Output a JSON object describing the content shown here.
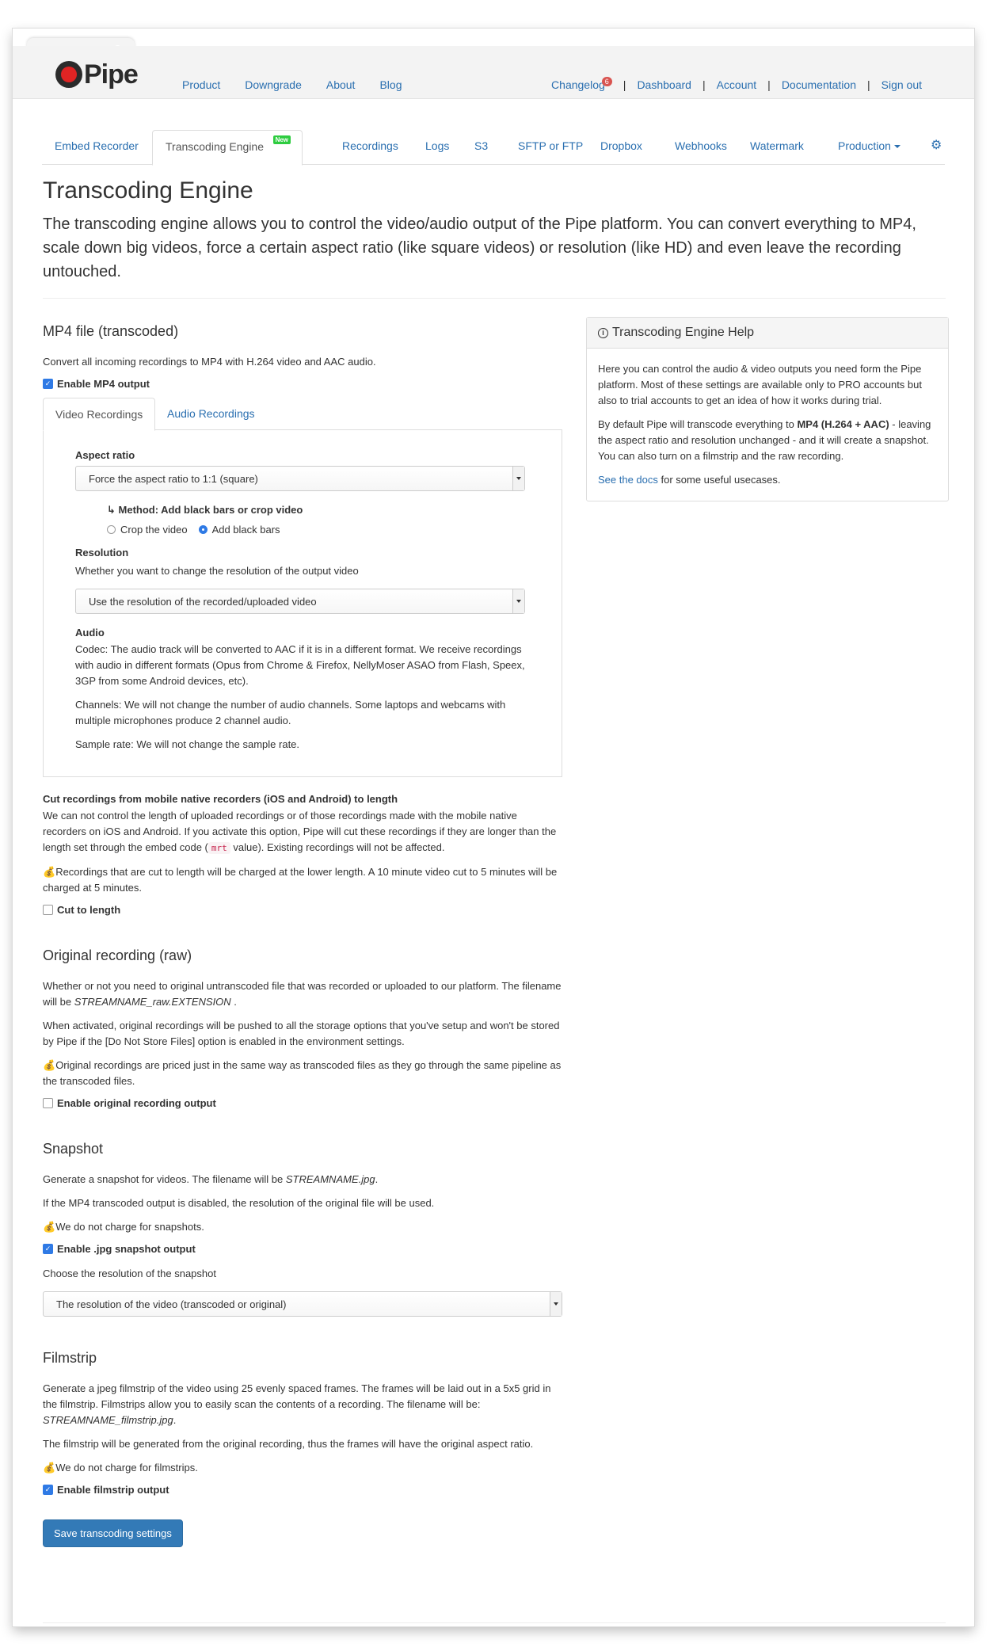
{
  "navbar": {
    "logo_text": "Pipe",
    "left_links": [
      "Product",
      "Downgrade",
      "About",
      "Blog"
    ],
    "changelog_label": "Changelog",
    "changelog_count": "6",
    "right_links": [
      "Dashboard",
      "Account",
      "Documentation",
      "Sign out"
    ]
  },
  "subtabs": {
    "items": [
      "Embed Recorder",
      "Transcoding Engine",
      "Recordings",
      "Logs",
      "S3",
      "SFTP or FTP",
      "Dropbox",
      "Webhooks",
      "Watermark"
    ],
    "new_badge": "New",
    "environment": "Production",
    "settings_icon": "gear-icon"
  },
  "page": {
    "title": "Transcoding Engine",
    "lead": "The transcoding engine allows you to control the video/audio output of the Pipe platform. You can convert everything to MP4, scale down big videos, force a certain aspect ratio (like square videos) or resolution (like HD) and even leave the recording untouched."
  },
  "mp4": {
    "title": "MP4 file (transcoded)",
    "desc": "Convert all incoming recordings to MP4 with H.264 video and AAC audio.",
    "enable_label": "Enable MP4 output",
    "enabled": true,
    "tabs": [
      "Video Recordings",
      "Audio Recordings"
    ],
    "aspect_label": "Aspect ratio",
    "aspect_value": "Force the aspect ratio to 1:1 (square)",
    "method_label": "↳ Method: Add black bars or crop video",
    "method_options": [
      "Crop the video",
      "Add black bars"
    ],
    "method_selected": "Add black bars",
    "resolution_label": "Resolution",
    "resolution_desc": "Whether you want to change the resolution of the output video",
    "resolution_value": "Use the resolution of the recorded/uploaded video",
    "audio_label": "Audio",
    "audio_codec": "Codec: The audio track will be converted to AAC if it is in a different format. We receive recordings with audio in different formats (Opus from Chrome & Firefox, NellyMoser ASAO from Flash, Speex, 3GP from some Android devices, etc).",
    "audio_channels": "Channels: We will not change the number of audio channels. Some laptops and webcams with multiple microphones produce 2 channel audio.",
    "audio_sample": "Sample rate: We will not change the sample rate."
  },
  "cut": {
    "title": "Cut recordings from mobile native recorders (iOS and Android) to length",
    "desc_before": "We can not control the length of uploaded recordings or of those recordings made with the mobile native recorders on iOS and Android. If you activate this option, Pipe will cut these recordings if they are longer than the length set through the embed code (",
    "code": "mrt",
    "desc_after": " value). Existing recordings will not be affected.",
    "charge_note": "Recordings that are cut to length will be charged at the lower length. A 10 minute video cut to 5 minutes will be charged at 5 minutes.",
    "checkbox_label": "Cut to length",
    "enabled": false
  },
  "original": {
    "title": "Original recording (raw)",
    "desc_before": "Whether or not you need to original untranscoded file that was recorded or uploaded to our platform. The filename will be ",
    "filename": "STREAMNAME_raw.EXTENSION",
    "desc_after": " .",
    "storage_note": "When activated, original recordings will be pushed to all the storage options that you've setup and won't be stored by Pipe if the [Do Not Store Files] option is enabled in the environment settings.",
    "charge_note": "Original recordings are priced just in the same way as transcoded files as they go through the same pipeline as the transcoded files.",
    "checkbox_label": "Enable original recording output",
    "enabled": false
  },
  "snapshot": {
    "title": "Snapshot",
    "desc_before": "Generate a snapshot for videos. The filename will be ",
    "filename": "STREAMNAME.jpg",
    "desc_after": ".",
    "note": "If the MP4 transcoded output is disabled, the resolution of the original file will be used.",
    "charge_note": "We do not charge for snapshots.",
    "checkbox_label": "Enable .jpg snapshot output",
    "enabled": true,
    "resolution_label": "Choose the resolution of the snapshot",
    "resolution_value": "The resolution of the video (transcoded or original)"
  },
  "filmstrip": {
    "title": "Filmstrip",
    "desc_before": "Generate a jpeg filmstrip of the video using 25 evenly spaced frames. The frames will be laid out in a 5x5 grid in the filmstrip. Filmstrips allow you to easily scan the contents of a recording. The filename will be: ",
    "filename": "STREAMNAME_filmstrip.jpg",
    "desc_after": ".",
    "note": "The filmstrip will be generated from the original recording, thus the frames will have the original aspect ratio.",
    "charge_note": "We do not charge for filmstrips.",
    "checkbox_label": "Enable filmstrip output",
    "enabled": true
  },
  "save_button": "Save transcoding settings",
  "help": {
    "title": "Transcoding Engine Help",
    "p1": "Here you can control the audio & video outputs you need form the Pipe platform. Most of these settings are available only to PRO accounts but also to trial accounts to get an idea of how it works during trial.",
    "p2_before": "By default Pipe will transcode everything to ",
    "p2_bold": "MP4 (H.264 + AAC)",
    "p2_after": " - leaving the aspect ratio and resolution unchanged - and it will create a snapshot. You can also turn on a filmstrip and the raw recording.",
    "p3_link": "See the docs",
    "p3_after": " for some useful usecases."
  },
  "icons": {
    "money": "money-bag-icon",
    "info": "info-icon"
  }
}
